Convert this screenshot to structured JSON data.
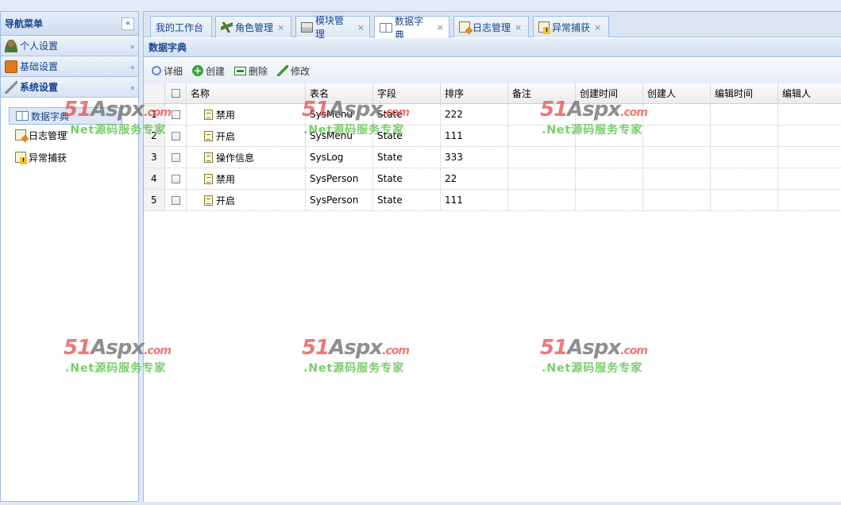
{
  "nav": {
    "title": "导航菜单",
    "collapse": "«",
    "groups": [
      {
        "label": "个人设置",
        "chev": "»",
        "icon": "user-icon"
      },
      {
        "label": "基础设置",
        "chev": "»",
        "icon": "settings-box-icon"
      },
      {
        "label": "系统设置",
        "chev": "«",
        "icon": "wrench-icon"
      }
    ],
    "items": [
      {
        "label": "数据字典",
        "icon": "book-icon",
        "selected": true
      },
      {
        "label": "日志管理",
        "icon": "log-edit-icon"
      },
      {
        "label": "异常捕获",
        "icon": "warning-doc-icon"
      }
    ]
  },
  "tabs": [
    {
      "label": "我的工作台",
      "closable": false,
      "icon": null
    },
    {
      "label": "角色管理",
      "closable": true,
      "icon": "role-icon"
    },
    {
      "label": "模块管理",
      "closable": true,
      "icon": "module-icon"
    },
    {
      "label": "数据字典",
      "closable": true,
      "icon": "book-icon",
      "active": true
    },
    {
      "label": "日志管理",
      "closable": true,
      "icon": "log-edit-icon"
    },
    {
      "label": "异常捕获",
      "closable": true,
      "icon": "warning-doc-icon"
    }
  ],
  "tab_close": "×",
  "panel": {
    "title": "数据字典"
  },
  "toolbar": {
    "detail": "详细",
    "create": "创建",
    "delete": "删除",
    "edit": "修改"
  },
  "grid": {
    "columns": [
      "名称",
      "表名",
      "字段",
      "排序",
      "备注",
      "创建时间",
      "创建人",
      "编辑时间",
      "编辑人"
    ],
    "rows": [
      {
        "num": "1",
        "name": "禁用",
        "table": "SysMenu",
        "field": "State",
        "sort": "222"
      },
      {
        "num": "2",
        "name": "开启",
        "table": "SysMenu",
        "field": "State",
        "sort": "111"
      },
      {
        "num": "3",
        "name": "操作信息",
        "table": "SysLog",
        "field": "State",
        "sort": "333"
      },
      {
        "num": "4",
        "name": "禁用",
        "table": "SysPerson",
        "field": "State",
        "sort": "22"
      },
      {
        "num": "5",
        "name": "开启",
        "table": "SysPerson",
        "field": "State",
        "sort": "111"
      }
    ]
  },
  "watermark": {
    "logo_num": "51",
    "logo_word": "Aspx",
    "logo_suffix": ".com",
    "sub": ".Net源码服务专家"
  }
}
